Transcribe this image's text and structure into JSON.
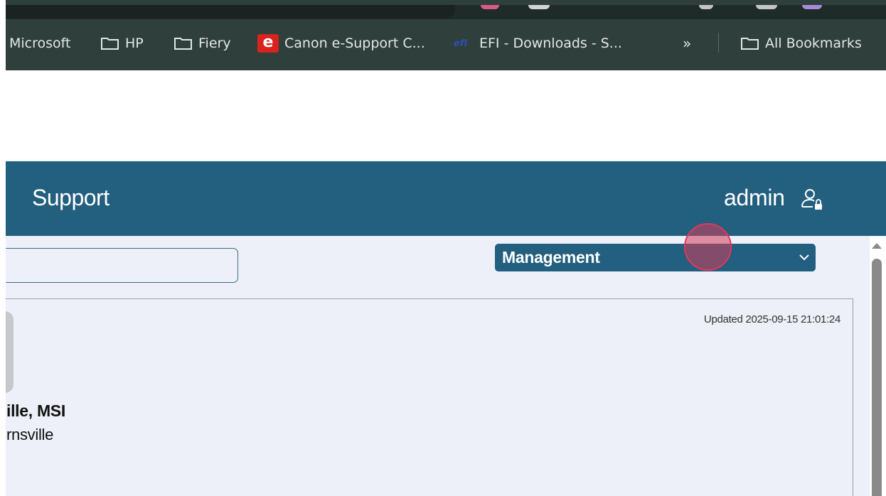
{
  "bookmarks_bar": {
    "items": [
      {
        "label": "Microsoft",
        "icon": "none"
      },
      {
        "label": "HP",
        "icon": "folder-icon"
      },
      {
        "label": "Fiery",
        "icon": "folder-icon"
      },
      {
        "label": "Canon e-Support C...",
        "icon": "canon-e-logo"
      },
      {
        "label": "EFI - Downloads - S...",
        "icon": "efi-logo"
      }
    ],
    "overflow_label": "»",
    "all_bookmarks_label": "All Bookmarks"
  },
  "app_header": {
    "title": "Support",
    "user_name": "admin",
    "user_icon": "user-lock-icon",
    "color": "#235f7f"
  },
  "toolbar": {
    "search_value": "",
    "select_value": "Management"
  },
  "card": {
    "updated_text": "Updated 2025-09-15 21:01:24",
    "name": "ille, MSI",
    "subtitle": "rnsville"
  },
  "icons": {
    "canon_logo_text": "e",
    "efi_logo_text": "efi"
  }
}
